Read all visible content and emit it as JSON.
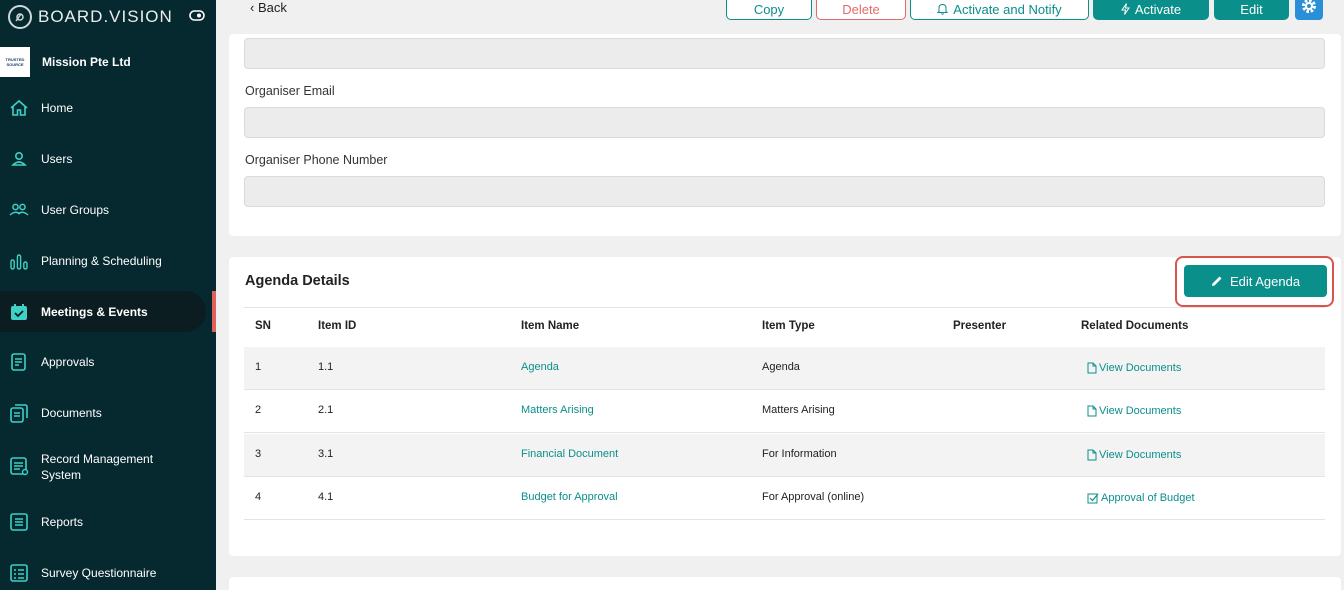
{
  "brand": {
    "name": "BOARD.VISION"
  },
  "org": {
    "name": "Mission Pte Ltd",
    "badge_top": "TRUSTED",
    "badge_bottom": "SOURCE"
  },
  "nav": [
    {
      "label": "Home",
      "icon": "home-icon"
    },
    {
      "label": "Users",
      "icon": "user-icon"
    },
    {
      "label": "User Groups",
      "icon": "users-icon"
    },
    {
      "label": "Planning & Scheduling",
      "icon": "bar-chart-icon"
    },
    {
      "label": "Meetings & Events",
      "icon": "calendar-icon",
      "active": true
    },
    {
      "label": "Approvals",
      "icon": "document-icon"
    },
    {
      "label": "Documents",
      "icon": "documents-icon"
    },
    {
      "label": "Record Management System",
      "icon": "archive-icon"
    },
    {
      "label": "Reports",
      "icon": "report-icon"
    },
    {
      "label": "Survey Questionnaire",
      "icon": "survey-icon"
    }
  ],
  "toolbar": {
    "back": "Back",
    "copy": "Copy",
    "delete": "Delete",
    "activate_notify": "Activate and Notify",
    "activate": "Activate",
    "edit": "Edit"
  },
  "organiser": {
    "email_label": "Organiser Email",
    "phone_label": "Organiser Phone Number"
  },
  "agenda": {
    "title": "Agenda Details",
    "edit_button": "Edit Agenda",
    "columns": [
      "SN",
      "Item ID",
      "Item Name",
      "Item Type",
      "Presenter",
      "Related Documents"
    ],
    "rows": [
      {
        "sn": "1",
        "id": "1.1",
        "name": "Agenda",
        "type": "Agenda",
        "presenter": "",
        "doc": "View Documents",
        "doc_icon": "file-icon"
      },
      {
        "sn": "2",
        "id": "2.1",
        "name": "Matters Arising",
        "type": "Matters Arising",
        "presenter": "",
        "doc": "View Documents",
        "doc_icon": "file-icon"
      },
      {
        "sn": "3",
        "id": "3.1",
        "name": "Financial Document",
        "type": "For Information",
        "presenter": "",
        "doc": "View Documents",
        "doc_icon": "file-icon"
      },
      {
        "sn": "4",
        "id": "4.1",
        "name": "Budget for Approval",
        "type": "For Approval (online)",
        "presenter": "",
        "doc": "Approval of Budget",
        "doc_icon": "checkbox-icon"
      }
    ]
  },
  "colors": {
    "accent": "#0a8f8a",
    "sidebar": "#06282f",
    "danger": "#e46a6a",
    "highlight": "#d9534f"
  }
}
